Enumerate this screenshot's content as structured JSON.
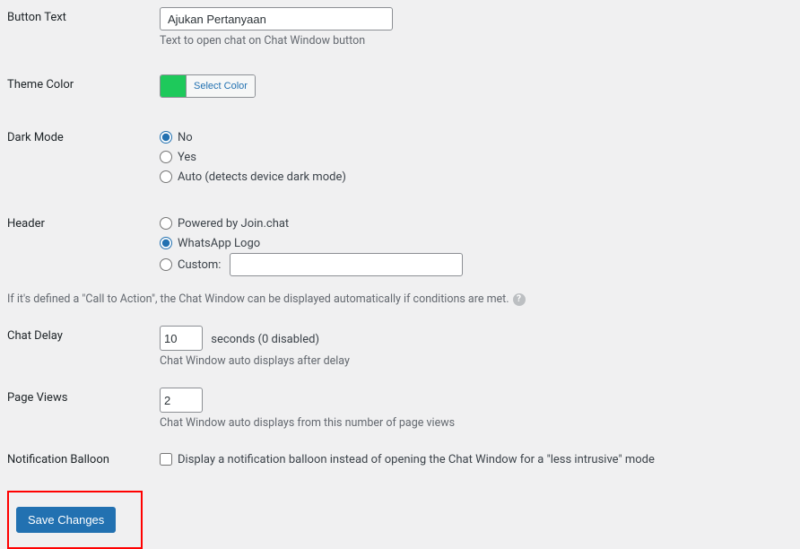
{
  "buttonText": {
    "label": "Button Text",
    "value": "Ajukan Pertanyaan",
    "desc": "Text to open chat on Chat Window button"
  },
  "themeColor": {
    "label": "Theme Color",
    "button": "Select Color",
    "swatch": "#1ec95b"
  },
  "darkMode": {
    "label": "Dark Mode",
    "options": {
      "no": "No",
      "yes": "Yes",
      "auto": "Auto (detects device dark mode)"
    },
    "selected": "no"
  },
  "header": {
    "label": "Header",
    "options": {
      "powered": "Powered by Join.chat",
      "wa": "WhatsApp Logo",
      "custom": "Custom:"
    },
    "selected": "wa",
    "customValue": ""
  },
  "ctaInfo": "If it's defined a \"Call to Action\", the Chat Window can be displayed automatically if conditions are met.",
  "chatDelay": {
    "label": "Chat Delay",
    "value": "10",
    "suffix": "seconds (0 disabled)",
    "desc": "Chat Window auto displays after delay"
  },
  "pageViews": {
    "label": "Page Views",
    "value": "2",
    "desc": "Chat Window auto displays from this number of page views"
  },
  "notification": {
    "label": "Notification Balloon",
    "checked": false,
    "text": "Display a notification balloon instead of opening the Chat Window for a \"less intrusive\" mode"
  },
  "save": "Save Changes"
}
